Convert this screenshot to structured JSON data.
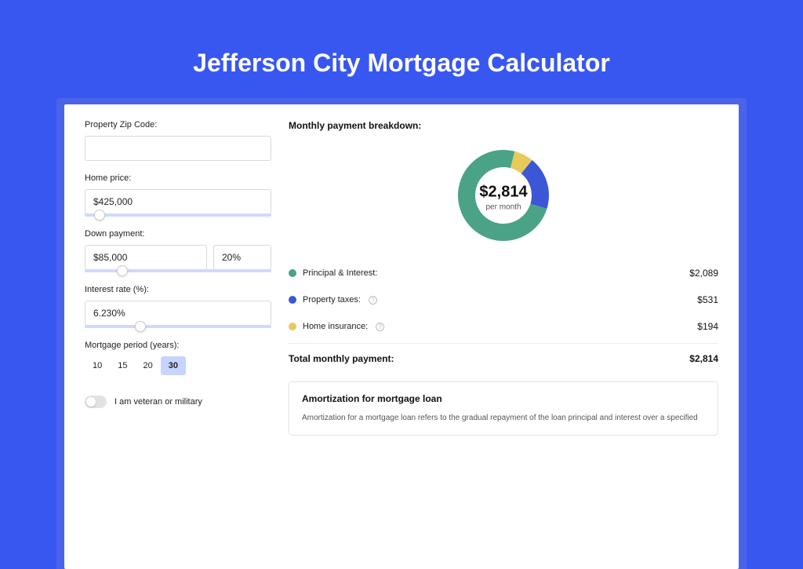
{
  "title": "Jefferson City Mortgage Calculator",
  "form": {
    "zip_label": "Property Zip Code:",
    "zip_value": "",
    "price_label": "Home price:",
    "price_value": "$425,000",
    "price_slider_pct": 8,
    "down_label": "Down payment:",
    "down_value": "$85,000",
    "down_pct_value": "20%",
    "down_slider_pct": 20,
    "rate_label": "Interest rate (%):",
    "rate_value": "6.230%",
    "rate_slider_pct": 30,
    "period_label": "Mortgage period (years):",
    "periods": [
      "10",
      "15",
      "20",
      "30"
    ],
    "period_active": "30",
    "veteran_label": "I am veteran or military"
  },
  "breakdown": {
    "title": "Monthly payment breakdown:",
    "amount": "$2,814",
    "sub": "per month",
    "items": [
      {
        "label": "Principal & Interest:",
        "value": "$2,089",
        "color": "#4aa387",
        "info": false,
        "num": 2089
      },
      {
        "label": "Property taxes:",
        "value": "$531",
        "color": "#3b56d6",
        "info": true,
        "num": 531
      },
      {
        "label": "Home insurance:",
        "value": "$194",
        "color": "#e8ca5b",
        "info": true,
        "num": 194
      }
    ],
    "total_label": "Total monthly payment:",
    "total_value": "$2,814"
  },
  "amortization": {
    "title": "Amortization for mortgage loan",
    "body": "Amortization for a mortgage loan refers to the gradual repayment of the loan principal and interest over a specified"
  },
  "chart_data": {
    "type": "pie",
    "title": "Monthly payment breakdown",
    "series": [
      {
        "name": "Principal & Interest",
        "value": 2089,
        "color": "#4aa387"
      },
      {
        "name": "Property taxes",
        "value": 531,
        "color": "#3b56d6"
      },
      {
        "name": "Home insurance",
        "value": 194,
        "color": "#e8ca5b"
      }
    ],
    "total": 2814,
    "center_label": "$2,814 per month"
  }
}
